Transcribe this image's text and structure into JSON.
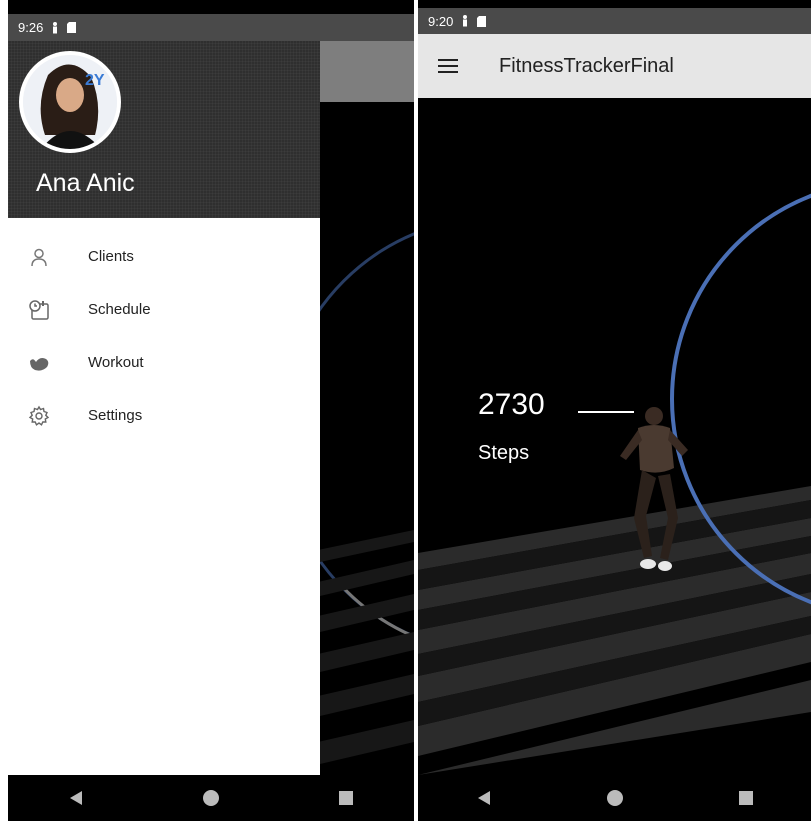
{
  "left_screen": {
    "status_bar": {
      "time": "9:26"
    },
    "drawer": {
      "header": {
        "user_name": "Ana Anic"
      },
      "items": [
        {
          "label": "Clients",
          "icon": "person-icon"
        },
        {
          "label": "Schedule",
          "icon": "calendar-clock-icon"
        },
        {
          "label": "Workout",
          "icon": "bicep-icon"
        },
        {
          "label": "Settings",
          "icon": "gear-icon"
        }
      ]
    }
  },
  "right_screen": {
    "status_bar": {
      "time": "9:20"
    },
    "app_bar": {
      "title": "FitnessTrackerFinal"
    },
    "steps": {
      "value": "2730",
      "label": "Steps",
      "progress_fraction": 0.65
    }
  },
  "colors": {
    "accent": "#4a6fb5",
    "status_bar": "#4a4a4a",
    "app_bar": "#e6e6e6",
    "drawer_header": "#2f2f2f"
  }
}
